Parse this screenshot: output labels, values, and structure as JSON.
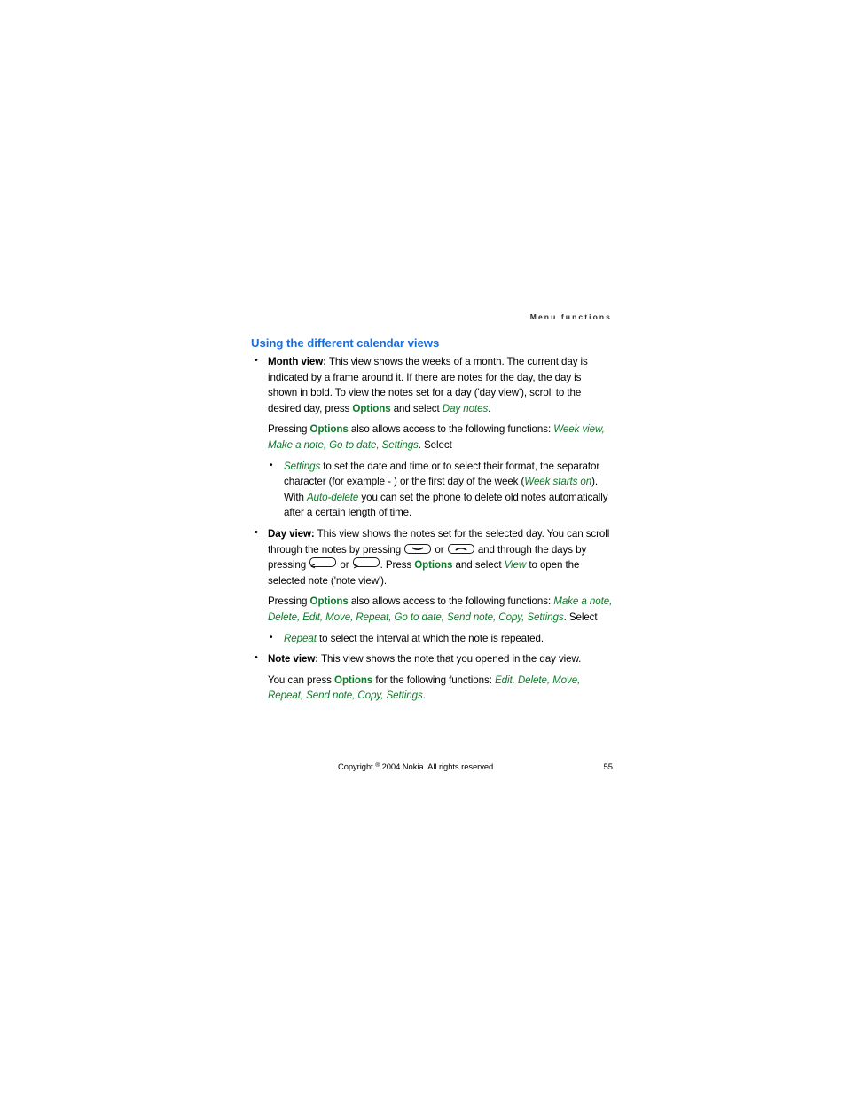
{
  "header": {
    "running_title": "Menu functions"
  },
  "heading": "Using the different calendar views",
  "sections": {
    "month_view": {
      "label": "Month view:",
      "body_1": " This view shows the weeks of a month. The current day is indicated by a frame around it. If there are notes for the day, the day is shown in bold. To view the notes set for a day ('day view'), scroll to the desired day, press ",
      "options_label": "Options",
      "body_2": " and select ",
      "day_notes": "Day notes",
      "body_3": ".",
      "options_para": {
        "pre": "Pressing ",
        "options_label": "Options",
        "mid": " also allows access to the following functions: ",
        "functions": "Week view, Make a note, Go to date, Settings",
        "post": ". Select"
      },
      "sub_bullet": {
        "settings": "Settings",
        "text_1": " to set the date and time or to select their format, the separator character (for example - ) or the first day of the week (",
        "week_starts_on": "Week starts on",
        "text_2": "). With ",
        "auto_delete": "Auto-delete",
        "text_3": " you can set the phone to delete old notes automatically after a certain length of time."
      }
    },
    "day_view": {
      "label": "Day view:",
      "body_1": " This view shows the notes set for the selected day. You can scroll through the notes by pressing ",
      "key_down": "scroll-down-key",
      "or_1": " or ",
      "key_up": "scroll-up-key",
      "body_2": " and through the days by pressing ",
      "key_left": "<",
      "or_2": " or ",
      "key_right": ">",
      "body_3": ". Press ",
      "options_label": "Options",
      "body_4": " and select ",
      "view": "View",
      "body_5": " to open the selected note ('note view').",
      "options_para": {
        "pre": "Pressing ",
        "options_label": "Options",
        "mid": " also allows access to the following functions: ",
        "functions": "Make a note, Delete, Edit, Move, Repeat, Go to date, Send note, Copy, Settings",
        "post": ". Select"
      },
      "sub_bullet": {
        "repeat": "Repeat",
        "text": " to select the interval at which the note is repeated."
      }
    },
    "note_view": {
      "label": "Note view:",
      "body_1": " This view shows the note that you opened in the day view.",
      "options_para": {
        "pre": "You can press ",
        "options_label": "Options",
        "mid": " for the following functions: ",
        "functions": "Edit, Delete, Move, Repeat, Send note, Copy, Settings",
        "post": "."
      }
    }
  },
  "footer": {
    "copyright_pre": "Copyright ",
    "copyright_symbol": "®",
    "copyright_post": " 2004 Nokia. All rights reserved.",
    "page_number": "55"
  },
  "colors": {
    "heading_blue": "#1a6ee0",
    "accent_green": "#0d7a28",
    "body_black": "#000000"
  }
}
